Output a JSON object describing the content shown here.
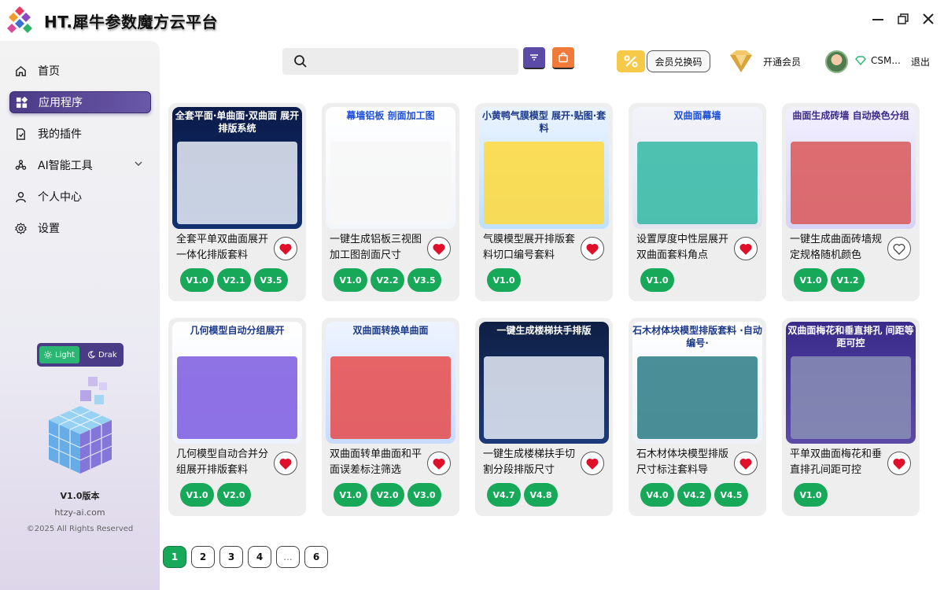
{
  "app": {
    "title": "HT.犀牛参数魔方云平台"
  },
  "sidebar": {
    "items": [
      {
        "label": "首页",
        "icon": "home-icon"
      },
      {
        "label": "应用程序",
        "icon": "apps-icon"
      },
      {
        "label": "我的插件",
        "icon": "plugin-icon"
      },
      {
        "label": "AI智能工具",
        "icon": "ai-icon"
      },
      {
        "label": "个人中心",
        "icon": "user-icon"
      },
      {
        "label": "设置",
        "icon": "settings-icon"
      }
    ],
    "theme": {
      "light": "Light",
      "dark": "Drak"
    },
    "version": "V1.0版本",
    "site": "htzy-ai.com",
    "copyright": "©2025 All Rights Reserved"
  },
  "header": {
    "search_placeholder": "",
    "redeem_label": "会员兑换码",
    "vip_label": "开通会员",
    "user_name": "CSM...",
    "logout_label": "退出"
  },
  "cards": [
    {
      "title": "全套平单双曲面展开一体化排版套料",
      "thumb_head": "全套平面·单曲面·双曲面 展开排版系统",
      "versions": [
        "V1.0",
        "V2.1",
        "V3.5"
      ],
      "favorited": true
    },
    {
      "title": "一键生成铝板三视图加工图剖面尺寸",
      "thumb_head": "幕墙铝板 剖面加工图",
      "versions": [
        "V1.0",
        "V2.2",
        "V3.5"
      ],
      "favorited": true
    },
    {
      "title": "气膜模型展开排版套料切口编号套料",
      "thumb_head": "小黄鸭气膜模型 展开·贴图·套料",
      "versions": [
        "V1.0"
      ],
      "favorited": true
    },
    {
      "title": "设置厚度中性层展开双曲面套料角点",
      "thumb_head": "双曲面幕墙",
      "versions": [
        "V1.0"
      ],
      "favorited": true
    },
    {
      "title": "一键生成曲面砖墙规定规格随机颜色",
      "thumb_head": "曲面生成砖墙 自动换色分组",
      "versions": [
        "V1.0",
        "V1.2"
      ],
      "favorited": false
    },
    {
      "title": "几何模型自动合并分组展开排版套料",
      "thumb_head": "几何模型自动分组展开",
      "versions": [
        "V1.0",
        "V2.0"
      ],
      "favorited": true
    },
    {
      "title": "双曲面转单曲面和平面误差标注筛选",
      "thumb_head": "双曲面转换单曲面",
      "versions": [
        "V1.0",
        "V2.0",
        "V3.0"
      ],
      "favorited": true
    },
    {
      "title": "一键生成楼梯扶手切割分段排版尺寸",
      "thumb_head": "一键生成楼梯扶手排版",
      "versions": [
        "V4.7",
        "V4.8"
      ],
      "favorited": true
    },
    {
      "title": "石木材体块模型排版尺寸标注套料导",
      "thumb_head": "石木材体块模型排版套料 ·自动编号·",
      "versions": [
        "V4.0",
        "V4.2",
        "V4.5"
      ],
      "favorited": true
    },
    {
      "title": "平单双曲面梅花和垂直排孔间距可控",
      "thumb_head": "双曲面梅花和垂直排孔 间距等距可控",
      "versions": [
        "V1.0"
      ],
      "favorited": true
    }
  ],
  "pagination": {
    "pages": [
      "1",
      "2",
      "3",
      "4",
      "...",
      "6"
    ],
    "current": "1"
  },
  "colors": {
    "accent": "#4b3a86",
    "green": "#17a85a",
    "heart": "#e0102a"
  }
}
